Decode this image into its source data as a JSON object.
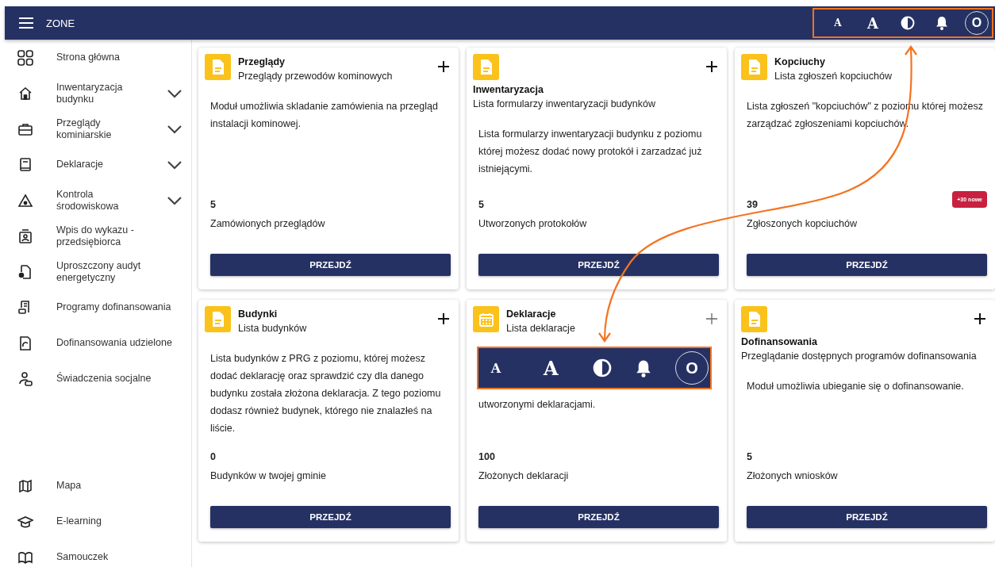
{
  "top_bar": {
    "title": "ZONE",
    "highlighted": true,
    "tools": [
      {
        "kind": "text-small",
        "label": "A"
      },
      {
        "kind": "text-large",
        "label": "A"
      },
      {
        "kind": "contrast"
      },
      {
        "kind": "bell"
      },
      {
        "kind": "avatar",
        "label": "O"
      }
    ]
  },
  "sidebar": {
    "items": [
      {
        "label": "Strona główna",
        "expandable": false
      },
      {
        "label": "Inwentaryzacja budynku",
        "expandable": true
      },
      {
        "label": "Przeglądy kominiarskie",
        "expandable": true
      },
      {
        "label": "Deklaracje",
        "expandable": true
      },
      {
        "label": "Kontrola środowiskowa",
        "expandable": true
      },
      {
        "label": "Wpis do wykazu - przedsiębiorca",
        "expandable": false
      },
      {
        "label": "Uproszczony audyt energetyczny",
        "expandable": false
      },
      {
        "label": "Programy dofinansowania",
        "expandable": false
      },
      {
        "label": "Dofinansowania udzielone",
        "expandable": false
      },
      {
        "label": "Świadczenia socjalne",
        "expandable": false
      }
    ],
    "bottom_items": [
      {
        "label": "Mapa",
        "expandable": false
      },
      {
        "label": "E-learning",
        "expandable": false
      },
      {
        "label": "Samouczek",
        "expandable": false
      }
    ]
  },
  "cards": [
    {
      "title": "Przeglądy",
      "subtitle": "Przeglądy przewodów kominowych",
      "kind": "inline",
      "icon": {
        "kind": "document"
      },
      "add_button": {
        "disabled": false
      },
      "description": "Moduł umożliwia skladanie zamówienia na przegląd instalacji kominowej.",
      "count": "5",
      "count_label": "Zamówionych przeglądów",
      "button": "PRZEJDŹ"
    },
    {
      "title": "Inwentaryzacja",
      "subtitle": "Lista formularzy inwentaryzacji budynków",
      "kind": "stacked",
      "icon": {
        "kind": "document"
      },
      "add_button": {
        "disabled": false
      },
      "description": "Lista formularzy inwentaryzacji budynku z poziomu której możesz dodać nowy protokół i zarzadzać już istniejącymi.",
      "count": "5",
      "count_label": "Utworzonych protokołów",
      "button": "PRZEJDŹ"
    },
    {
      "title": "Kopciuchy",
      "subtitle": "Lista zgłoszeń kopciuchów",
      "kind": "inline",
      "icon": {
        "kind": "document"
      },
      "description": "Lista zgłoszeń \"kopciuchów\" z poziomu której możesz zarządzać zgłoszeniami kopciuchów.",
      "count": "39",
      "badge": "+30 nowe",
      "count_label": "Zgłoszonych kopciuchów",
      "button": "PRZEJDŹ"
    },
    {
      "title": "Budynki",
      "subtitle": "Lista budynków",
      "kind": "inline",
      "icon": {
        "kind": "document"
      },
      "add_button": {
        "disabled": false
      },
      "description": "Lista budynków z PRG z poziomu, której możesz dodać deklarację oraz sprawdzić czy dla danego budynku została złożona deklaracja. Z tego poziomu dodasz również budynek, którego nie znalazłeś na liście.",
      "count": "0",
      "count_label": "Budynków w twojej gminie",
      "button": "PRZEJDŹ"
    },
    {
      "title": "Deklaracje",
      "subtitle": "Lista deklaracje",
      "kind": "inline",
      "icon": {
        "kind": "calendar"
      },
      "add_button": {
        "disabled": true
      },
      "callout": {
        "tools": [
          {
            "kind": "text-small",
            "label": "A"
          },
          {
            "kind": "text-large",
            "label": "A"
          },
          {
            "kind": "contrast"
          },
          {
            "kind": "bell"
          },
          {
            "kind": "avatar",
            "label": "O"
          }
        ]
      },
      "description": "utworzonymi deklaracjami.",
      "count": "100",
      "count_label": "Złożonych deklaracji",
      "button": "PRZEJDŹ"
    },
    {
      "title": "Dofinansowania",
      "subtitle": "Przeglądanie dostępnych programów dofinansowania",
      "kind": "stacked",
      "icon": {
        "kind": "document"
      },
      "add_button": {
        "disabled": false
      },
      "description": "Moduł umożliwia ubieganie się o dofinansowanie.",
      "count": "5",
      "count_label": "Złożonych wniosków",
      "button": "PRZEJDŹ"
    }
  ]
}
